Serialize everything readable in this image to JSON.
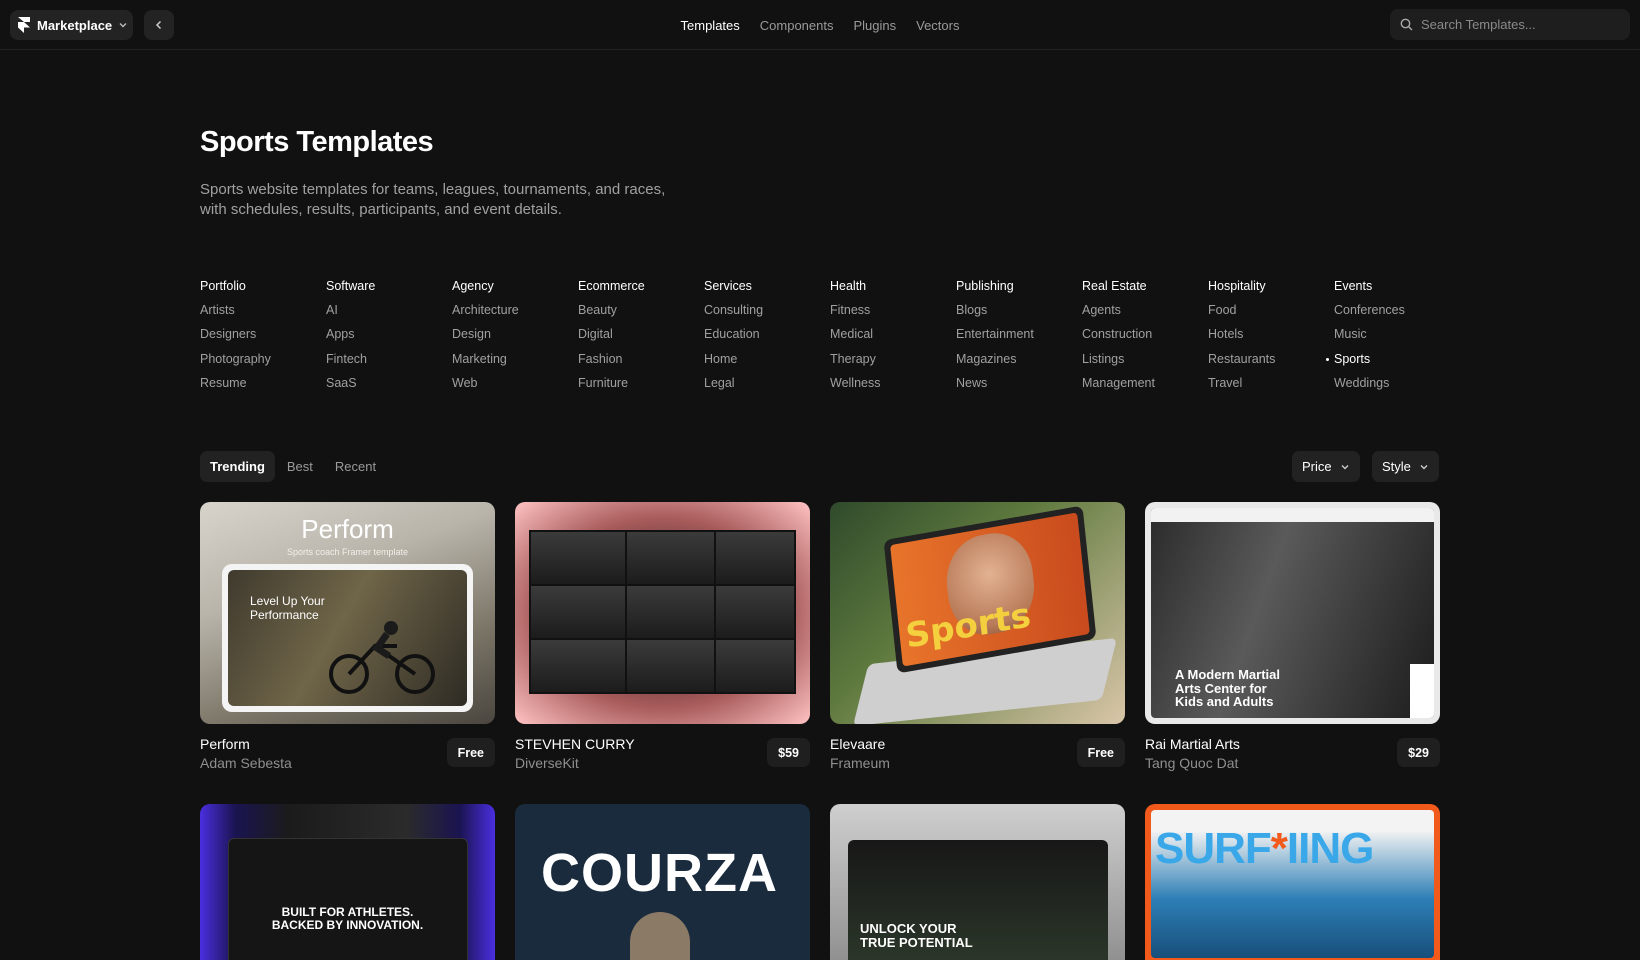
{
  "topbar": {
    "app_label": "Marketplace",
    "nav": [
      "Templates",
      "Components",
      "Plugins",
      "Vectors"
    ],
    "active_nav": 0,
    "search_placeholder": "Search Templates..."
  },
  "hero": {
    "title": "Sports Templates",
    "description": "Sports website templates for teams, leagues, tournaments, and races, with schedules, results, participants, and event details."
  },
  "categories": [
    {
      "head": "Portfolio",
      "items": [
        "Artists",
        "Designers",
        "Photography",
        "Resume"
      ]
    },
    {
      "head": "Software",
      "items": [
        "AI",
        "Apps",
        "Fintech",
        "SaaS"
      ]
    },
    {
      "head": "Agency",
      "items": [
        "Architecture",
        "Design",
        "Marketing",
        "Web"
      ]
    },
    {
      "head": "Ecommerce",
      "items": [
        "Beauty",
        "Digital",
        "Fashion",
        "Furniture"
      ]
    },
    {
      "head": "Services",
      "items": [
        "Consulting",
        "Education",
        "Home",
        "Legal"
      ]
    },
    {
      "head": "Health",
      "items": [
        "Fitness",
        "Medical",
        "Therapy",
        "Wellness"
      ]
    },
    {
      "head": "Publishing",
      "items": [
        "Blogs",
        "Entertainment",
        "Magazines",
        "News"
      ]
    },
    {
      "head": "Real Estate",
      "items": [
        "Agents",
        "Construction",
        "Listings",
        "Management"
      ]
    },
    {
      "head": "Hospitality",
      "items": [
        "Food",
        "Hotels",
        "Restaurants",
        "Travel"
      ]
    },
    {
      "head": "Events",
      "items": [
        "Conferences",
        "Music",
        "Sports",
        "Weddings"
      ]
    }
  ],
  "active_category": "Sports",
  "filters": {
    "tabs": [
      "Trending",
      "Best",
      "Recent"
    ],
    "active_tab": 0,
    "price_label": "Price",
    "style_label": "Style"
  },
  "cards": [
    {
      "title": "Perform",
      "author": "Adam Sebesta",
      "price": "Free",
      "thumb": {
        "headline": "Perform",
        "sub": "Sports coach Framer template",
        "tagline_1": "Level Up Your",
        "tagline_2": "Performance"
      }
    },
    {
      "title": "STEVHEN CURRY",
      "author": "DiverseKit",
      "price": "$59",
      "thumb": {}
    },
    {
      "title": "Elevaare",
      "author": "Frameum",
      "price": "Free",
      "thumb": {
        "word": "Sports"
      }
    },
    {
      "title": "Rai Martial Arts",
      "author": "Tang Quoc Dat",
      "price": "$29",
      "thumb": {
        "line_1": "A Modern Martial",
        "line_2": "Arts Center for",
        "line_3": "Kids and Adults"
      }
    }
  ],
  "cards_row2": [
    {
      "thumb": {
        "line_1": "BUILT FOR ATHLETES.",
        "line_2": "BACKED BY INNOVATION."
      }
    },
    {
      "thumb": {
        "word": "COURZA"
      }
    },
    {
      "thumb": {
        "line_1": "UNLOCK YOUR",
        "line_2": "TRUE POTENTIAL"
      }
    },
    {
      "thumb": {
        "word_a": "SURF",
        "word_b": "*",
        "word_c": "IING"
      }
    }
  ]
}
